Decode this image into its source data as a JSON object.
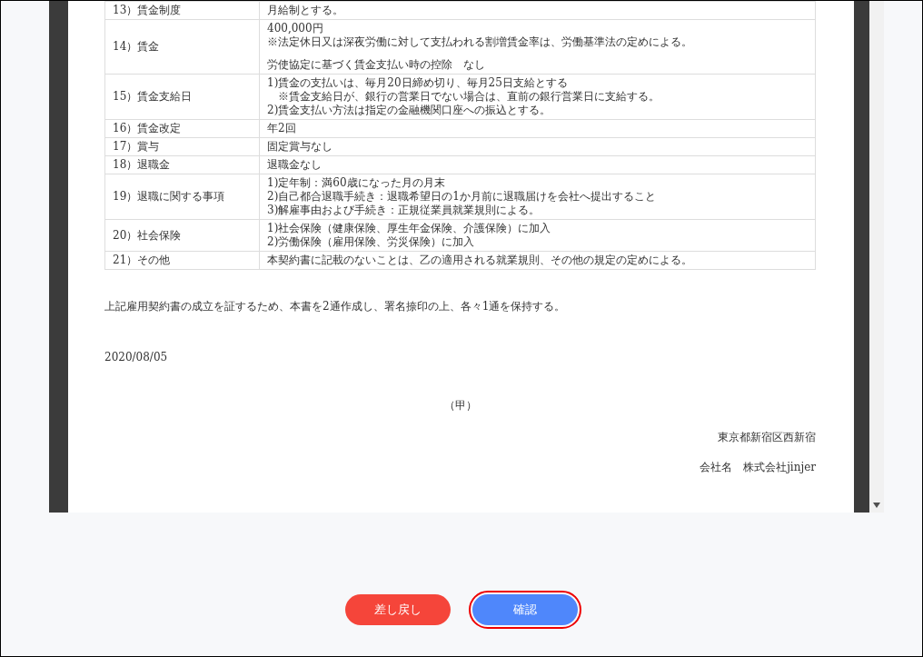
{
  "document": {
    "rows": [
      {
        "label": "13）賃金制度",
        "paragraphs": [
          [
            "月給制とする。"
          ]
        ]
      },
      {
        "label": "14）賃金",
        "paragraphs": [
          [
            "400,000円",
            "※法定休日又は深夜労働に対して支払われる割増賃金率は、労働基準法の定めによる。"
          ],
          [
            "労使協定に基づく賃金支払い時の控除　なし"
          ]
        ]
      },
      {
        "label": "15）賃金支給日",
        "paragraphs": [
          [
            "1)賃金の支払いは、毎月20日締め切り、毎月25日支給とする",
            "　※賃金支給日が、銀行の営業日でない場合は、直前の銀行営業日に支給する。",
            "2)賃金支払い方法は指定の金融機関口座への振込とする。"
          ]
        ]
      },
      {
        "label": "16）賃金改定",
        "paragraphs": [
          [
            "年2回"
          ]
        ]
      },
      {
        "label": "17）賞与",
        "paragraphs": [
          [
            "固定賞与なし"
          ]
        ]
      },
      {
        "label": "18）退職金",
        "paragraphs": [
          [
            "退職金なし"
          ]
        ]
      },
      {
        "label": "19）退職に関する事項",
        "paragraphs": [
          [
            "1)定年制：満60歳になった月の月末",
            "2)自己都合退職手続き：退職希望日の1か月前に退職届けを会社へ提出すること",
            "3)解雇事由および手続き：正規従業員就業規則による。"
          ]
        ]
      },
      {
        "label": "20）社会保険",
        "paragraphs": [
          [
            "1)社会保険（健康保険、厚生年金保険、介護保険）に加入",
            "2)労働保険（雇用保険、労災保険）に加入"
          ]
        ]
      },
      {
        "label": "21）その他",
        "paragraphs": [
          [
            "本契約書に記載のないことは、乙の適用される就業規則、その他の規定の定めによる。"
          ]
        ]
      }
    ],
    "statement": "上記雇用契約書の成立を証するため、本書を2通作成し、署名捺印の上、各々1通を保持する。",
    "date": "2020/08/05",
    "party": "（甲）",
    "address": "東京都新宿区西新宿",
    "company": "会社名　株式会社jinjer"
  },
  "buttons": [
    {
      "label": "差し戻し",
      "kind": "reject",
      "highlighted": false
    },
    {
      "label": "確認",
      "kind": "confirm",
      "highlighted": true
    }
  ]
}
